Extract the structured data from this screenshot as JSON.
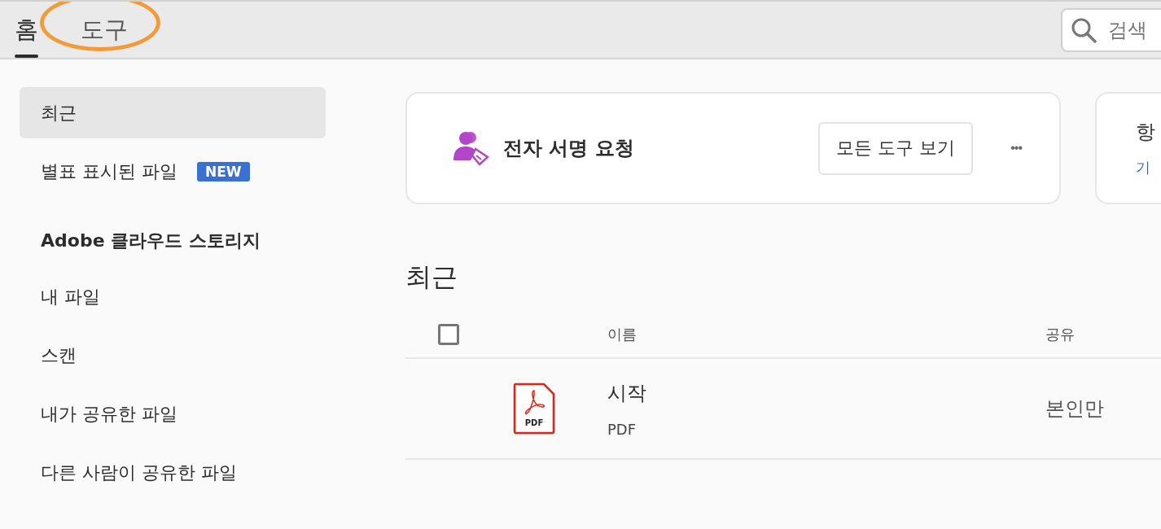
{
  "tabs": [
    {
      "label": "홈",
      "selected": true,
      "highlighted": false
    },
    {
      "label": "도구",
      "selected": false,
      "highlighted": true
    }
  ],
  "search": {
    "placeholder": "검색"
  },
  "sidebar": {
    "items": [
      {
        "label": "최근",
        "selected": true
      },
      {
        "label": "별표 표시된 파일",
        "selected": false,
        "badge": "NEW"
      }
    ],
    "section_title": "Adobe 클라우드 스토리지",
    "section_items": [
      {
        "label": "내 파일",
        "selected": false
      },
      {
        "label": "스캔",
        "selected": false
      },
      {
        "label": "내가 공유한 파일",
        "selected": false
      },
      {
        "label": "다른 사람이 공유한 파일",
        "selected": false
      }
    ]
  },
  "tool_card": {
    "title": "전자 서명 요청",
    "button": "모든 도구 보기",
    "more": "•••"
  },
  "side_card": {
    "title": "항",
    "link": "기"
  },
  "recent": {
    "title": "최근",
    "columns": [
      "이름",
      "공유"
    ],
    "select_all_checked": false,
    "rows": [
      {
        "icon_label": "PDF",
        "name": "시작",
        "type": "PDF",
        "sharing": "본인만"
      }
    ]
  }
}
